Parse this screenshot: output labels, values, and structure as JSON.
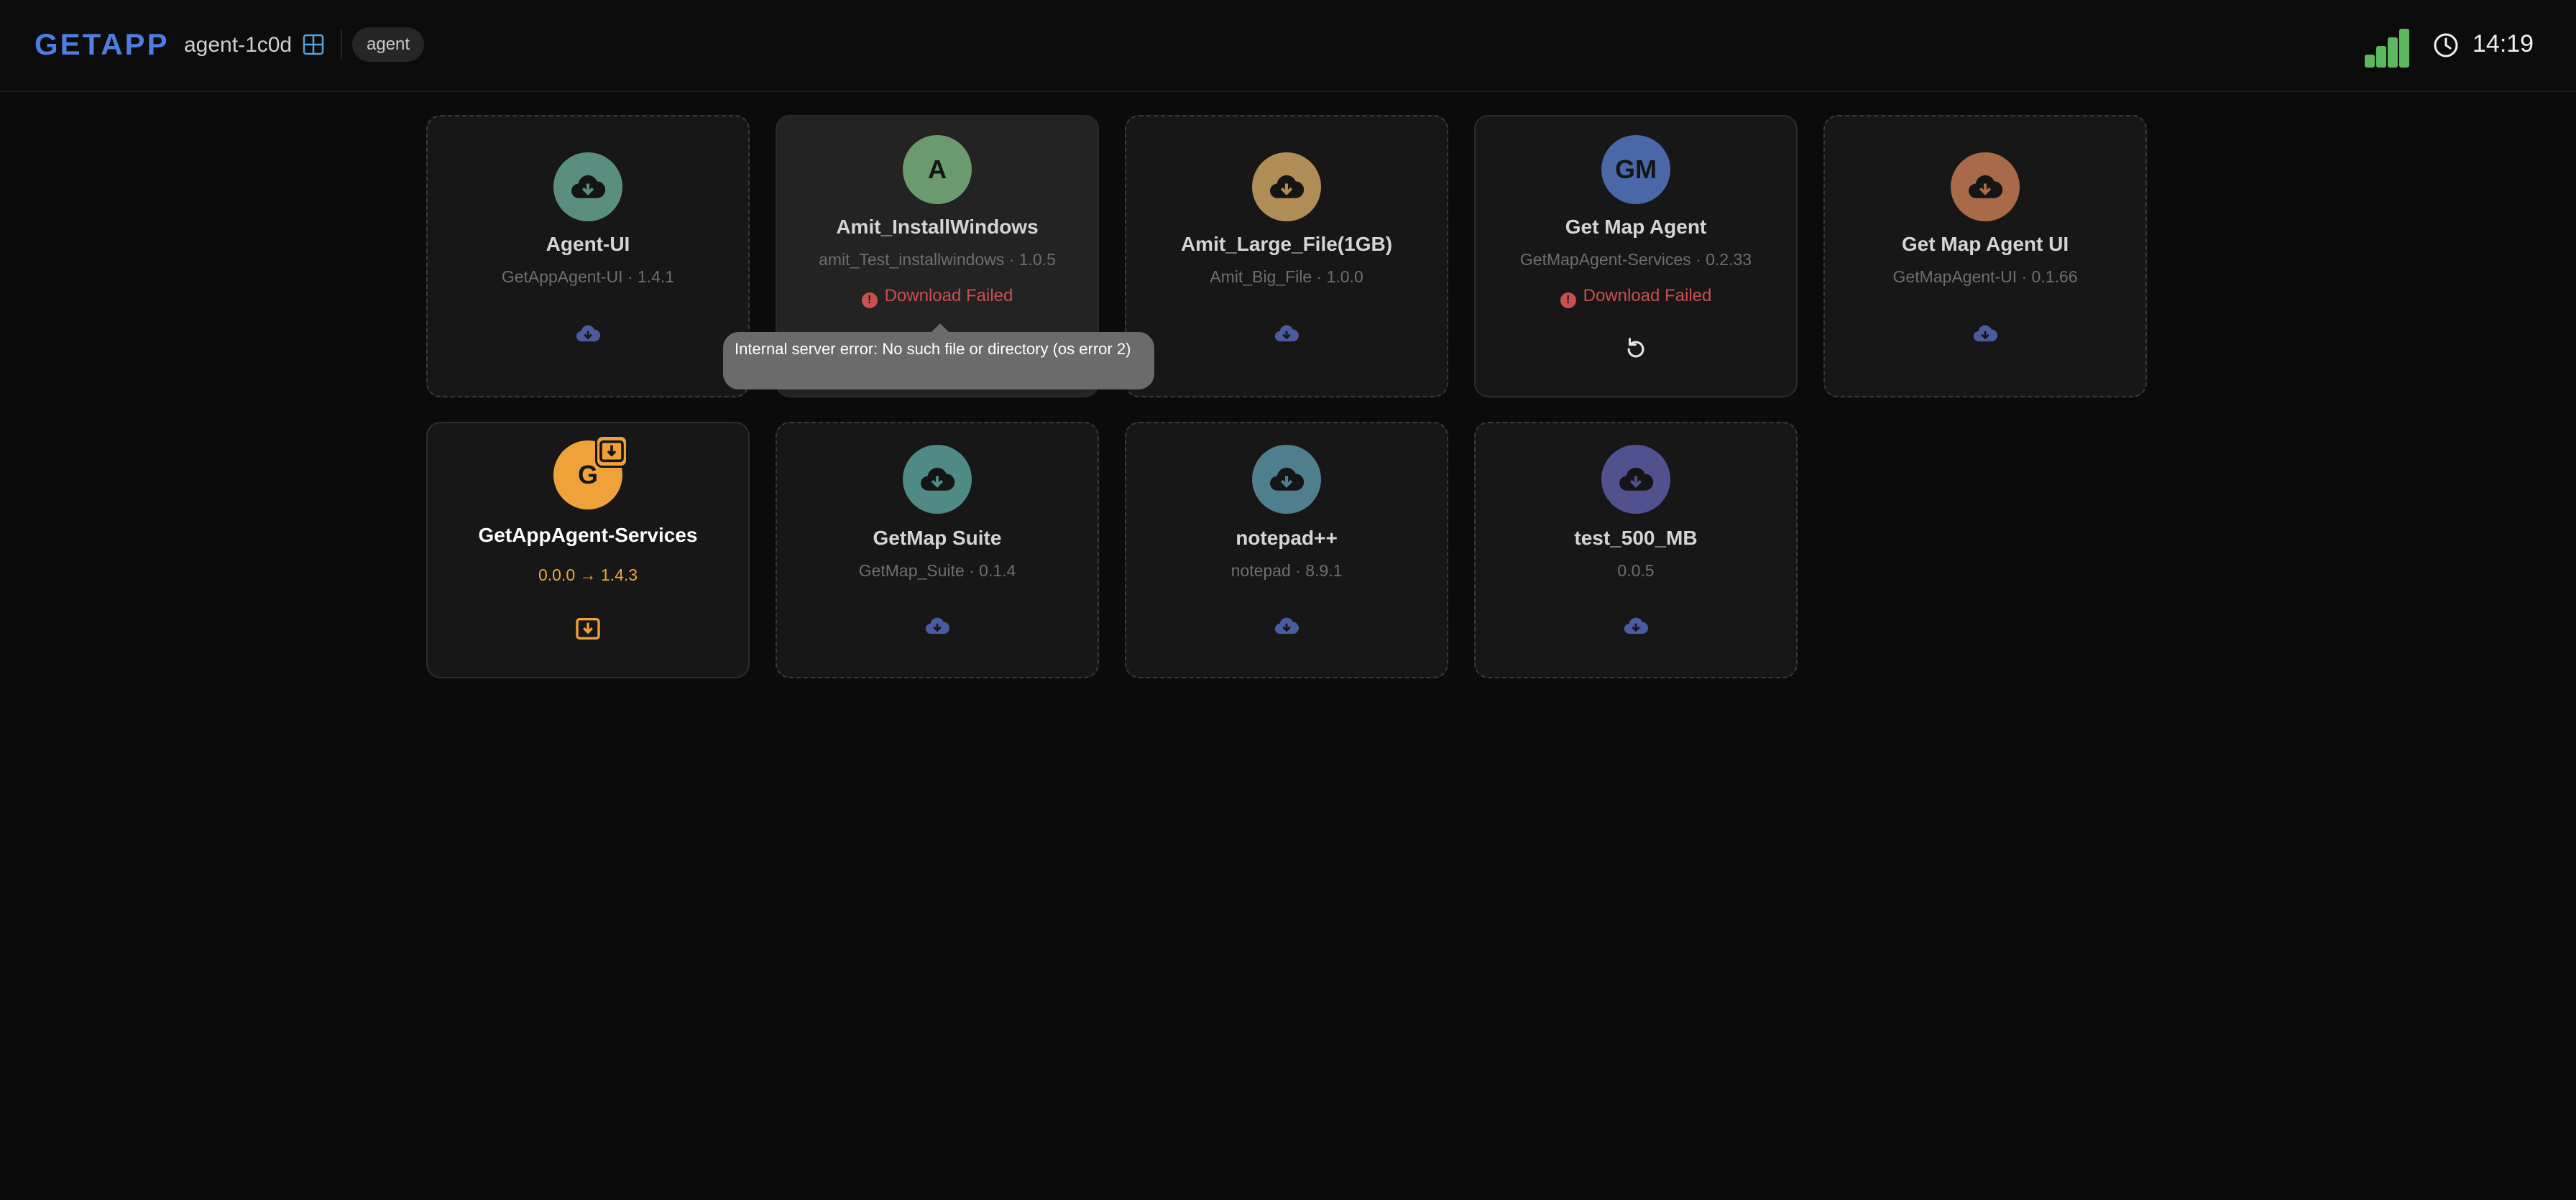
{
  "header": {
    "brand": "GETAPP",
    "agent_name": "agent-1c0d",
    "os_icon": "windows-icon",
    "role_chip": "agent",
    "signal_icon": "signal-strength-icon",
    "clock_icon": "clock-icon",
    "time": "14:19"
  },
  "colors": {
    "brand": "#4f7de0",
    "error": "#c9504f",
    "update": "#f0a23a",
    "download_icon": "#4a5b9e",
    "signal": "#5cb85c"
  },
  "cards": [
    {
      "title": "Agent-UI",
      "subtitle": "GetAppAgent-UI · 1.4.1",
      "avatar_icon": "cloud-download-icon",
      "avatar_color": "#5a8f80",
      "action_icon": "cloud-download-icon"
    },
    {
      "title": "Amit_InstallWindows",
      "subtitle": "amit_Test_installwindows · 1.0.5",
      "avatar_text": "A",
      "avatar_color": "#6b9a6e",
      "status": "Download Failed",
      "status_icon": "error-icon"
    },
    {
      "title": "Amit_Large_File(1GB)",
      "subtitle": "Amit_Big_File · 1.0.0",
      "avatar_icon": "cloud-download-icon",
      "avatar_color": "#b08d57",
      "action_icon": "cloud-download-icon"
    },
    {
      "title": "Get Map Agent",
      "subtitle": "GetMapAgent-Services · 0.2.33",
      "avatar_text": "GM",
      "avatar_color": "#4a68a8",
      "status": "Download Failed",
      "status_icon": "error-icon",
      "action_icon": "retry-icon"
    },
    {
      "title": "Get Map Agent UI",
      "subtitle": "GetMapAgent-UI · 0.1.66",
      "avatar_icon": "cloud-download-icon",
      "avatar_color": "#a86a48",
      "action_icon": "cloud-download-icon"
    },
    {
      "title": "GetAppAgent-Services",
      "subtitle": "0.0.0 → 1.4.3",
      "avatar_text": "G",
      "avatar_color": "#f0a23a",
      "badge_icon": "update-icon",
      "action_icon": "install-update-icon"
    },
    {
      "title": "GetMap Suite",
      "subtitle": "GetMap_Suite · 0.1.4",
      "avatar_icon": "cloud-download-icon",
      "avatar_color": "#4f8a85",
      "action_icon": "cloud-download-icon"
    },
    {
      "title": "notepad++",
      "subtitle": "notepad · 8.9.1",
      "avatar_icon": "cloud-download-icon",
      "avatar_color": "#4f7f8f",
      "action_icon": "cloud-download-icon"
    },
    {
      "title": "test_500_MB",
      "subtitle": "0.0.5",
      "avatar_icon": "cloud-download-icon",
      "avatar_color": "#51518f",
      "action_icon": "cloud-download-icon"
    }
  ],
  "tooltip": {
    "text": "Internal server error: No such file or directory (os error 2)"
  }
}
